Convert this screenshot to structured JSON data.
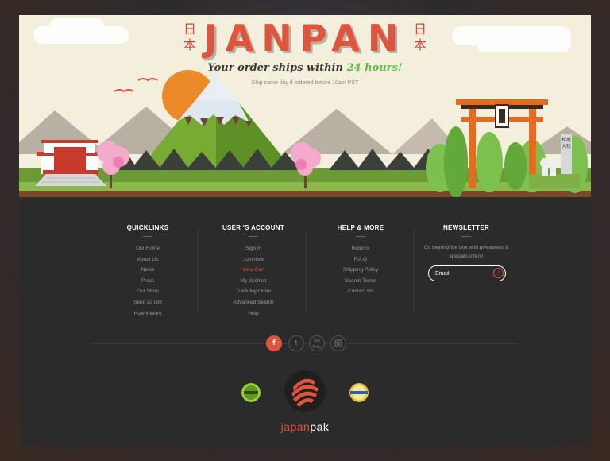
{
  "hero": {
    "logo": "JANPAN",
    "kanji_left": [
      "日",
      "本"
    ],
    "kanji_right": [
      "日",
      "本"
    ],
    "tagline_prefix": "Your order ships within ",
    "tagline_highlight": "24 hours!",
    "subtext": "Ship same day if ordered before 10am PST",
    "shrine_sign": "松尾大社"
  },
  "footer": {
    "quicklinks": {
      "title": "QUICKLINKS",
      "items": [
        "Our Home",
        "About Us",
        "News",
        "Press",
        "Our Shop",
        "Send as Gift",
        "How it Work"
      ]
    },
    "account": {
      "title": "USER 'S ACCOUNT",
      "items": [
        "Sign in",
        "Join now",
        "View Cart",
        "My Wishlist",
        "Track My Order",
        "Advanced Search",
        "Help"
      ]
    },
    "help": {
      "title": "HELP & MORE",
      "items": [
        "Returns",
        "F.A.Q",
        "Shipping Policy",
        "Search Terms",
        "Contact Us"
      ]
    },
    "newsletter": {
      "title": "NEWSLETTER",
      "text": "Go beyond the box with giveaways & specials offers!",
      "email_placeholder": "Email",
      "submit_icon": "check-icon"
    },
    "social": [
      "f",
      "t",
      "You Tube",
      "instagram-icon"
    ],
    "badges": [
      "security",
      "satisfaction"
    ],
    "brand_left": "japan",
    "brand_right": "pak"
  },
  "colors": {
    "accent": "#e0533d",
    "green": "#5abf3f",
    "footer_bg": "#2b2b2b",
    "hero_bg": "#f4eedc"
  }
}
